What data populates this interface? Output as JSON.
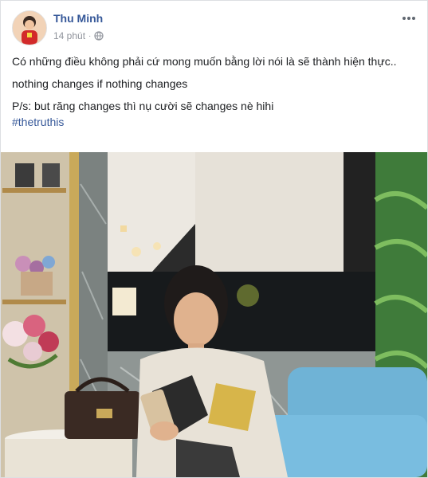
{
  "post": {
    "author": "Thu Minh",
    "time": "14 phút",
    "privacy_icon": "globe-icon",
    "more_icon": "more-options-icon",
    "lines": [
      "Có những điều không phải cứ mong muốn bằng lời nói là sẽ thành hiện thực..",
      "nothing changes if nothing changes",
      "P/s: but răng changes thì nụ cười sẽ changes nè hihi"
    ],
    "hashtag": "#thetruthis"
  },
  "colors": {
    "link": "#365899",
    "meta": "#90949c",
    "text": "#1c1e21"
  }
}
